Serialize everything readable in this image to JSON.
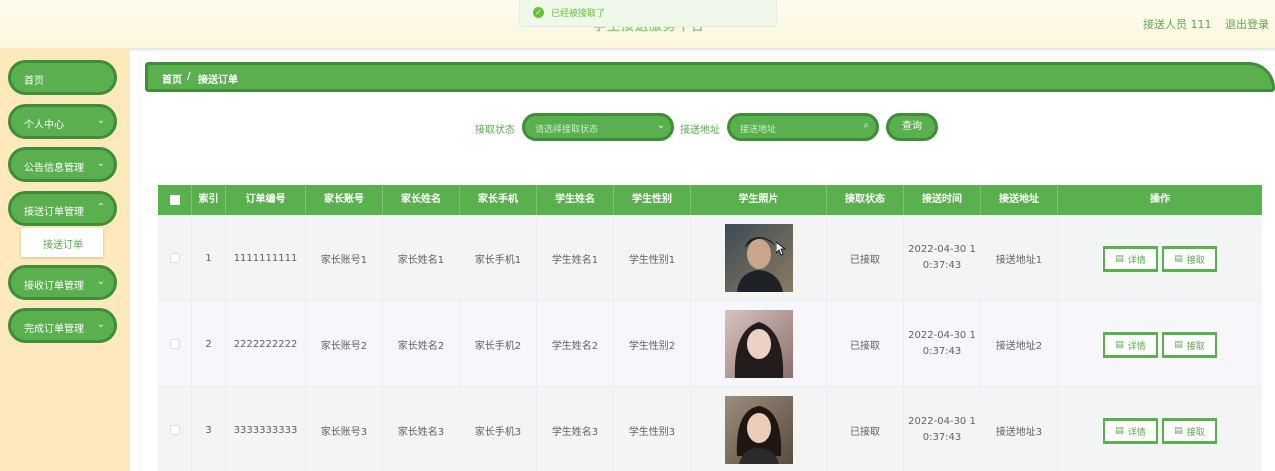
{
  "header": {
    "site_title": "学生接送服务平台",
    "toast": "已经被接取了",
    "toast_icon": "check-circle-icon",
    "user": "接送人员 111",
    "logout": "退出登录"
  },
  "sidebar": {
    "items": [
      {
        "label": "首页"
      },
      {
        "label": "个人中心"
      },
      {
        "label": "公告信息管理"
      },
      {
        "label": "接送订单管理"
      },
      {
        "label": "接收订单管理"
      },
      {
        "label": "完成订单管理"
      }
    ],
    "sub_item": "接送订单",
    "chevron": "⌄"
  },
  "breadcrumb": {
    "home": "首页",
    "sep": "/",
    "current": "接送订单"
  },
  "search": {
    "status_label": "接取状态",
    "status_placeholder": "请选择接取状态",
    "address_label": "接送地址",
    "address_placeholder": "接送地址",
    "button": "查询"
  },
  "table": {
    "headers": [
      "索引",
      "订单编号",
      "家长账号",
      "家长姓名",
      "家长手机",
      "学生姓名",
      "学生性别",
      "学生照片",
      "接取状态",
      "接送时间",
      "接送地址",
      "操作"
    ],
    "rows": [
      {
        "index": "1",
        "order_no": "1111111111",
        "parent_account": "家长账号1",
        "parent_name": "家长姓名1",
        "parent_phone": "家长手机1",
        "student_name": "学生姓名1",
        "student_gender": "学生性别1",
        "status": "已接取",
        "time": "2022-04-30 10:37:43",
        "address": "接送地址1"
      },
      {
        "index": "2",
        "order_no": "2222222222",
        "parent_account": "家长账号2",
        "parent_name": "家长姓名2",
        "parent_phone": "家长手机2",
        "student_name": "学生姓名2",
        "student_gender": "学生性别2",
        "status": "已接取",
        "time": "2022-04-30 10:37:43",
        "address": "接送地址2"
      },
      {
        "index": "3",
        "order_no": "3333333333",
        "parent_account": "家长账号3",
        "parent_name": "家长姓名3",
        "parent_phone": "家长手机3",
        "student_name": "学生姓名3",
        "student_gender": "学生性别3",
        "status": "已接取",
        "time": "2022-04-30 10:37:43",
        "address": "接送地址3"
      }
    ],
    "actions": {
      "detail": "详情",
      "pickup": "接取"
    }
  },
  "colors": {
    "primary": "#5aaf4e",
    "primary_border": "#3d8e36",
    "sidebar_bg": "#fde9bb"
  }
}
